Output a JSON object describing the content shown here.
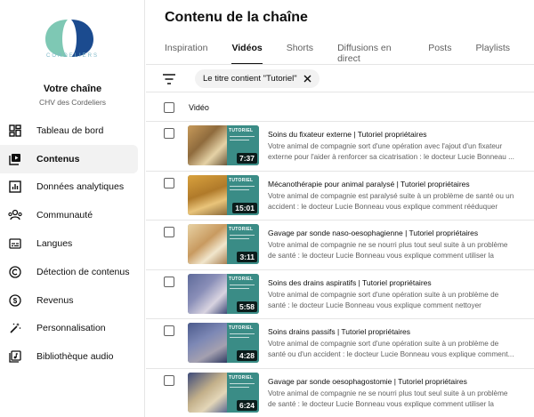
{
  "brand": {
    "logo_text": "CORDELIERS",
    "colors": {
      "teal": "#7ec8b4",
      "navy": "#1b4b8f"
    }
  },
  "sidebar": {
    "channel_title": "Votre chaîne",
    "channel_name": "CHV des Cordeliers",
    "items": [
      {
        "label": "Tableau de bord",
        "icon": "dashboard-icon"
      },
      {
        "label": "Contenus",
        "icon": "content-icon",
        "active": true
      },
      {
        "label": "Données analytiques",
        "icon": "analytics-icon"
      },
      {
        "label": "Communauté",
        "icon": "community-icon"
      },
      {
        "label": "Langues",
        "icon": "subtitles-icon"
      },
      {
        "label": "Détection de contenus",
        "icon": "copyright-icon"
      },
      {
        "label": "Revenus",
        "icon": "monetization-icon"
      },
      {
        "label": "Personnalisation",
        "icon": "magic-wand-icon"
      },
      {
        "label": "Bibliothèque audio",
        "icon": "audio-library-icon"
      }
    ]
  },
  "main": {
    "title": "Contenu de la chaîne",
    "tabs": [
      {
        "label": "Inspiration"
      },
      {
        "label": "Vidéos",
        "active": true
      },
      {
        "label": "Shorts"
      },
      {
        "label": "Diffusions en direct"
      },
      {
        "label": "Posts"
      },
      {
        "label": "Playlists"
      }
    ],
    "filter_chip": "Le titre contient \"Tutoriel\"",
    "column_header": "Vidéo",
    "thumb_label": "TUTORIEL",
    "videos": [
      {
        "title": "Soins du fixateur externe | Tutoriel propriétaires",
        "description": "Votre animal de compagnie sort d'une opération avec l'ajout d'un fixateur externe pour l'aider à renforcer sa cicatrisation : le docteur Lucie Bonneau ...",
        "duration": "7:37"
      },
      {
        "title": "Mécanothérapie pour animal paralysé | Tutoriel propriétaires",
        "description": "Votre animal de compagnie est paralysé suite à un problème de santé ou un accident : le docteur Lucie Bonneau vous explique comment rééduquer ses...",
        "duration": "15:01"
      },
      {
        "title": "Gavage par sonde naso-oesophagienne | Tutoriel propriétaires",
        "description": "Votre animal de compagnie ne se nourri plus tout seul suite à un problème de santé : le docteur Lucie Bonneau vous explique comment utiliser la sonde...",
        "duration": "3:11"
      },
      {
        "title": "Soins des drains aspiratifs | Tutoriel propriétaires",
        "description": "Votre animal de compagnie sort d'une opération suite à un problème de santé : le docteur Lucie Bonneau vous explique comment nettoyer efficacement le...",
        "duration": "5:58"
      },
      {
        "title": "Soins drains passifs | Tutoriel propriétaires",
        "description": "Votre animal de compagnie sort d'une opération suite à un problème de santé ou d'un accident : le docteur Lucie Bonneau vous explique comment...",
        "duration": "4:28"
      },
      {
        "title": "Gavage par sonde oesophagostomie | Tutoriel propriétaires",
        "description": "Votre animal de compagnie ne se nourri plus tout seul suite à un problème de santé : le docteur Lucie Bonneau vous explique comment utiliser la sonde...",
        "duration": "6:24"
      }
    ]
  }
}
